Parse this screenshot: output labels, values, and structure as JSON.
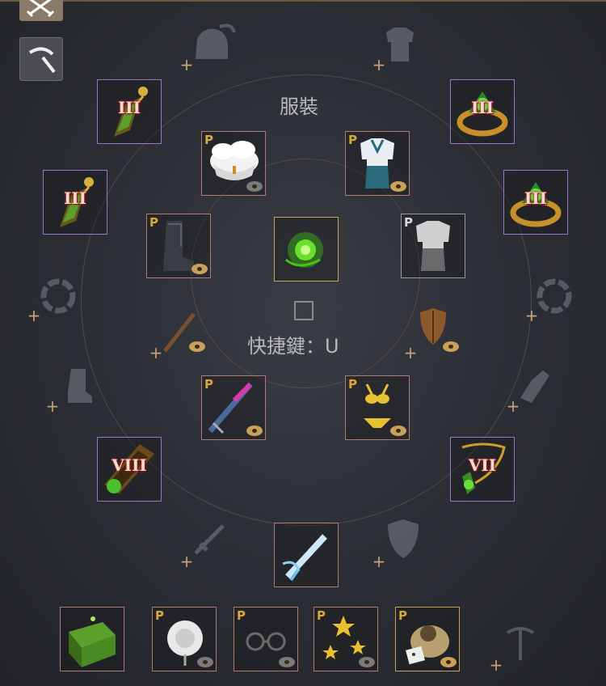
{
  "labels": {
    "costume_title": "服裝",
    "shortcut": "快捷鍵：U"
  },
  "badges": {
    "premium": "P",
    "tier_3": "III",
    "tier_8": "VIII",
    "tier_7": "VII"
  },
  "colors": {
    "rose_border": "#b07a6e",
    "purple_border": "#9a75c9",
    "gold_border": "#c9a15a",
    "plus_marker": "#c9a27a"
  }
}
